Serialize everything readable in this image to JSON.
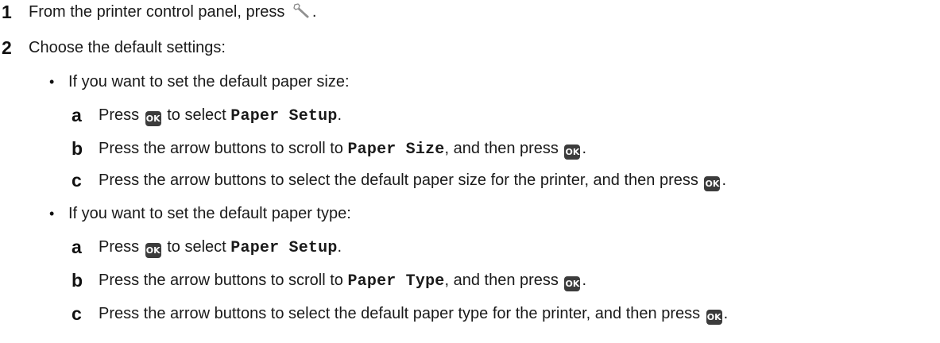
{
  "steps": [
    {
      "number": "1",
      "text_before": "From the printer control panel, press ",
      "text_after": ".",
      "icon": "wrench-icon"
    },
    {
      "number": "2",
      "text": "Choose the default settings:"
    }
  ],
  "options": [
    {
      "bullet": "•",
      "text": "If you want to set the default paper size:",
      "substeps": [
        {
          "letter": "a",
          "pre": "Press ",
          "ok": "OK",
          "mid": " to select ",
          "code": "Paper Setup",
          "post": "."
        },
        {
          "letter": "b",
          "pre": "Press the arrow buttons to scroll to ",
          "code": "Paper Size",
          "mid": ", and then press ",
          "ok": "OK",
          "post": "."
        },
        {
          "letter": "c",
          "pre": "Press the arrow buttons to select the default paper size for the printer, and then press ",
          "ok": "OK",
          "post": "."
        }
      ]
    },
    {
      "bullet": "•",
      "text": "If you want to set the default paper type:",
      "substeps": [
        {
          "letter": "a",
          "pre": "Press ",
          "ok": "OK",
          "mid": " to select ",
          "code": "Paper Setup",
          "post": "."
        },
        {
          "letter": "b",
          "pre": "Press the arrow buttons to scroll to ",
          "code": "Paper Type",
          "mid": ", and then press ",
          "ok": "OK",
          "post": "."
        },
        {
          "letter": "c",
          "pre": "Press the arrow buttons to select the default paper type for the printer, and then press ",
          "ok": "OK",
          "post": "."
        }
      ]
    }
  ],
  "colors": {
    "text": "#1a1a1a",
    "ok_button_bg": "#3c3c3c",
    "ok_button_fg": "#ffffff"
  }
}
